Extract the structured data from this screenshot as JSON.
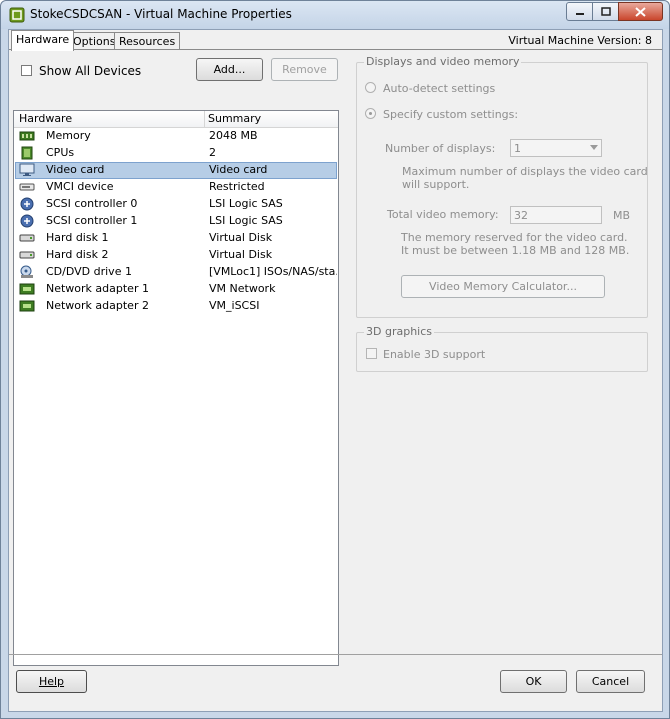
{
  "window": {
    "title": "StokeCSDCSAN - Virtual Machine Properties"
  },
  "tabs": [
    {
      "label": "Hardware"
    },
    {
      "label": "Options"
    },
    {
      "label": "Resources"
    }
  ],
  "vm_version": "Virtual Machine Version: 8",
  "hardware": {
    "show_all_label": "Show All Devices",
    "add_label": "Add...",
    "remove_label": "Remove",
    "columns": {
      "name": "Hardware",
      "summary": "Summary"
    },
    "items": [
      {
        "name": "Memory",
        "summary": "2048 MB",
        "icon": "memory-icon"
      },
      {
        "name": "CPUs",
        "summary": "2",
        "icon": "cpu-icon"
      },
      {
        "name": "Video card",
        "summary": "Video card",
        "icon": "monitor-icon"
      },
      {
        "name": "VMCI device",
        "summary": "Restricted",
        "icon": "device-icon"
      },
      {
        "name": "SCSI controller 0",
        "summary": "LSI Logic SAS",
        "icon": "scsi-controller-icon"
      },
      {
        "name": "SCSI controller 1",
        "summary": "LSI Logic SAS",
        "icon": "scsi-controller-icon"
      },
      {
        "name": "Hard disk 1",
        "summary": "Virtual Disk",
        "icon": "hard-disk-icon"
      },
      {
        "name": "Hard disk 2",
        "summary": "Virtual Disk",
        "icon": "hard-disk-icon"
      },
      {
        "name": "CD/DVD drive 1",
        "summary": "[VMLoc1] ISOs/NAS/sta...",
        "icon": "cd-drive-icon"
      },
      {
        "name": "Network adapter 1",
        "summary": "VM Network",
        "icon": "network-adapter-icon"
      },
      {
        "name": "Network adapter 2",
        "summary": "VM_iSCSI",
        "icon": "network-adapter-icon"
      }
    ]
  },
  "display": {
    "legend": "Displays and video memory",
    "auto_detect": "Auto-detect settings",
    "custom": "Specify custom settings:",
    "num_displays_label": "Number of displays:",
    "num_displays_value": "1",
    "max_displays_note_1": "Maximum number of displays the video card",
    "max_displays_note_2": "will support.",
    "total_memory_label": "Total video memory:",
    "total_memory_value": "32",
    "memory_unit": "MB",
    "memory_note_1": "The memory reserved for the video card.",
    "memory_note_2": "It must be between 1.18 MB and 128 MB.",
    "calculator_label": "Video Memory Calculator..."
  },
  "graphics3d": {
    "legend": "3D graphics",
    "enable_label": "Enable 3D support"
  },
  "footer": {
    "help_label": "Help",
    "ok_label": "OK",
    "cancel_label": "Cancel"
  },
  "colors": {
    "selection": "#b6cde6",
    "frame": "#c9d7e8",
    "close": "#c9462c"
  }
}
